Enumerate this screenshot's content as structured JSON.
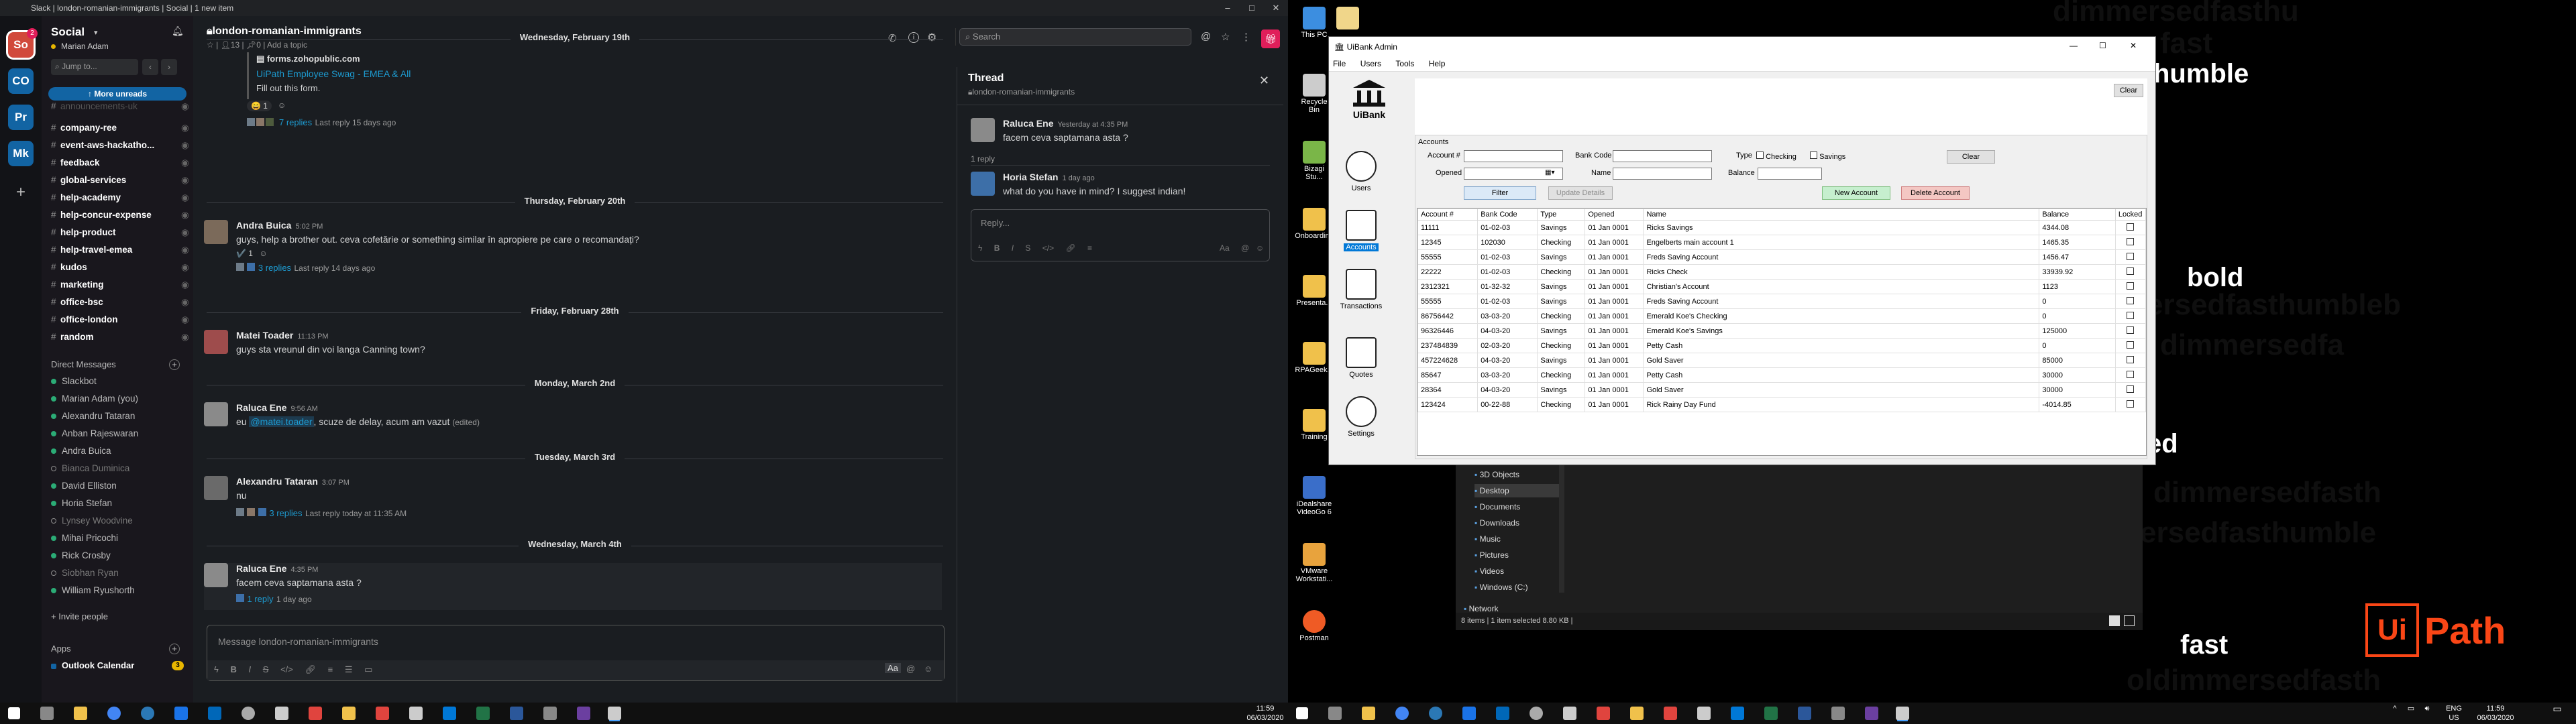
{
  "slack": {
    "window_title": "Slack | london-romanian-immigrants | Social | 1 new item",
    "workspaces": [
      {
        "label": "So",
        "color": "#d1493b",
        "badge": "2"
      },
      {
        "label": "CO",
        "color": "#1264a3"
      },
      {
        "label": "Pr",
        "color": "#1264a3"
      },
      {
        "label": "Mk",
        "color": "#1264a3"
      }
    ],
    "add_workspace": "+",
    "workspace_name": "Social",
    "user_name": "Marian Adam",
    "jump_placeholder": "Jump to...",
    "more_unreads": "More unreads",
    "channels": [
      "announcements-uk",
      "company-ree",
      "event-aws-hackatho...",
      "feedback",
      "global-services",
      "help-academy",
      "help-concur-expense",
      "help-product",
      "help-travel-emea",
      "kudos",
      "marketing",
      "office-bsc",
      "office-london",
      "random"
    ],
    "dm_header": "Direct Messages",
    "dms": [
      {
        "name": "Slackbot",
        "online": true
      },
      {
        "name": "Marian Adam (you)",
        "online": true
      },
      {
        "name": "Alexandru Tataran",
        "online": true
      },
      {
        "name": "Anban Rajeswaran",
        "online": true
      },
      {
        "name": "Andra Buica",
        "online": true
      },
      {
        "name": "Bianca Duminica",
        "online": false
      },
      {
        "name": "David Elliston",
        "online": true
      },
      {
        "name": "Horia Stefan",
        "online": true
      },
      {
        "name": "Lynsey Woodvine",
        "online": false
      },
      {
        "name": "Mihai Pricochi",
        "online": true
      },
      {
        "name": "Rick Crosby",
        "online": true
      },
      {
        "name": "Siobhan Ryan",
        "online": false
      },
      {
        "name": "William Ryushorth",
        "online": true
      }
    ],
    "invite_people": "+ Invite people",
    "apps_header": "Apps",
    "apps": [
      {
        "name": "Outlook Calendar",
        "badge": "3"
      }
    ],
    "channel_header": {
      "name": "london-romanian-immigrants",
      "members": "13",
      "pins": "0",
      "add_topic": "Add a topic"
    },
    "search_placeholder": "Search",
    "messages_top": {
      "link_domain": "forms.zohopublic.com",
      "link_title": "UiPath Employee Swag - EMEA & All",
      "link_desc": "Fill out this form.",
      "reactions": "1",
      "replies": "7 replies",
      "last_reply": "Last reply 15 days ago"
    },
    "feed": [
      {
        "type": "date",
        "label": "Wednesday, February 19th"
      },
      {
        "type": "date",
        "label": "Thursday, February 20th"
      },
      {
        "type": "msg",
        "author": "Andra Buica",
        "time": "5:02 PM",
        "text": "guys, help a brother out. ceva cofetărie or something similar în apropiere pe care o recomandați?",
        "reaction": "1",
        "replies": "3 replies",
        "last_reply": "Last reply 14 days ago"
      },
      {
        "type": "date",
        "label": "Friday, February 28th"
      },
      {
        "type": "msg",
        "author": "Matei Toader",
        "time": "11:13 PM",
        "text": "guys sta vreunul din voi langa Canning town?"
      },
      {
        "type": "date",
        "label": "Monday, March 2nd"
      },
      {
        "type": "msg",
        "author": "Raluca Ene",
        "time": "9:56 AM",
        "text_prefix": "eu",
        "mention": "@matei.toader",
        "text_suffix": ", scuze de delay, acum am vazut",
        "edited": "(edited)"
      },
      {
        "type": "date",
        "label": "Tuesday, March 3rd"
      },
      {
        "type": "msg",
        "author": "Alexandru Tataran",
        "time": "3:07 PM",
        "text": "nu",
        "replies": "3 replies",
        "last_reply": "Last reply today at 11:35 AM"
      },
      {
        "type": "date",
        "label": "Wednesday, March 4th"
      },
      {
        "type": "msg",
        "author": "Raluca Ene",
        "time": "4:35 PM",
        "text": "facem ceva saptamana asta ?",
        "replies": "1 reply",
        "last_reply": "1 day ago"
      }
    ],
    "composer_placeholder": "Message london-romanian-immigrants",
    "thread": {
      "title": "Thread",
      "channel": "london-romanian-immigrants",
      "root_author": "Raluca Ene",
      "root_time": "Yesterday at 4:35 PM",
      "root_text": "facem ceva saptamana asta ?",
      "reply_count": "1 reply",
      "reply_author": "Horia Stefan",
      "reply_time": "1 day ago",
      "reply_text": "what do you have in mind? I suggest indian!",
      "reply_placeholder": "Reply..."
    }
  },
  "desktop": {
    "bg_words": [
      "dimmersedfasthu",
      "fast",
      "dimmersedfastl",
      "humble",
      "bold",
      "ersedfasthumbleb",
      "dimmersedfa",
      "ed",
      "fast",
      "dimmersedfasth",
      "ersedfasthumble",
      "oldimmersedfasth"
    ],
    "highlight_words": [
      "humble",
      "bold",
      "ed",
      "fast"
    ],
    "icons": [
      "This PC",
      "",
      "Recycle Bin",
      "Bizagi Stu...",
      "Onboarding",
      "Presenta...",
      "RPAGeek...",
      "Training",
      "iDealshare VideoGo 6",
      "VMware Workstati...",
      "Postman"
    ],
    "brand_logo": "UiPath",
    "explorer": {
      "tree": [
        "3D Objects",
        "Desktop",
        "Documents",
        "Downloads",
        "Music",
        "Pictures",
        "Videos",
        "Windows (C:)",
        "Network"
      ],
      "status": "8 items  |  1 item selected  8.80 KB  |"
    }
  },
  "uibank": {
    "title": "UiBank Admin",
    "menu": [
      "File",
      "Users",
      "Tools",
      "Help"
    ],
    "logo_label": "UiBank",
    "clear_top": "Clear",
    "nav": [
      "Users",
      "Accounts",
      "Transactions",
      "Quotes",
      "Settings"
    ],
    "section": "Accounts",
    "form": {
      "account_label": "Account #",
      "bank_code_label": "Bank Code",
      "type_label": "Type",
      "checking_label": "Checking",
      "savings_label": "Savings",
      "clear_label": "Clear",
      "opened_label": "Opened",
      "name_label": "Name",
      "balance_label": "Balance",
      "filter_label": "Filter",
      "update_label": "Update Details",
      "new_account_label": "New Account",
      "delete_account_label": "Delete Account"
    },
    "columns": [
      "Account #",
      "Bank Code",
      "Type",
      "Opened",
      "Name",
      "Balance",
      "Locked"
    ],
    "rows": [
      [
        "11111",
        "01-02-03",
        "Savings",
        "01 Jan 0001",
        "Ricks Savings",
        "4344.08"
      ],
      [
        "12345",
        "102030",
        "Checking",
        "01 Jan 0001",
        "Engelberts main account 1",
        "1465.35"
      ],
      [
        "55555",
        "01-02-03",
        "Savings",
        "01 Jan 0001",
        "Freds Saving Account",
        "1456.47"
      ],
      [
        "22222",
        "01-02-03",
        "Checking",
        "01 Jan 0001",
        "Ricks Check",
        "33939.92"
      ],
      [
        "2312321",
        "01-32-32",
        "Savings",
        "01 Jan 0001",
        "Christian's Account",
        "1123"
      ],
      [
        "55555",
        "01-02-03",
        "Savings",
        "01 Jan 0001",
        "Freds Saving Account",
        "0"
      ],
      [
        "86756442",
        "03-03-20",
        "Checking",
        "01 Jan 0001",
        "Emerald Koe's Checking",
        "0"
      ],
      [
        "96326446",
        "04-03-20",
        "Savings",
        "01 Jan 0001",
        "Emerald Koe's Savings",
        "125000"
      ],
      [
        "237484839",
        "02-03-20",
        "Checking",
        "01 Jan 0001",
        "Petty Cash",
        "0"
      ],
      [
        "457224628",
        "04-03-20",
        "Savings",
        "01 Jan 0001",
        "Gold Saver",
        "85000"
      ],
      [
        "85647",
        "03-03-20",
        "Checking",
        "01 Jan 0001",
        "Petty Cash",
        "30000"
      ],
      [
        "28364",
        "04-03-20",
        "Savings",
        "01 Jan 0001",
        "Gold Saver",
        "30000"
      ],
      [
        "123424",
        "00-22-88",
        "Checking",
        "01 Jan 0001",
        "Rick Rainy Day Fund",
        "-4014.85"
      ]
    ]
  },
  "taskbar": {
    "left_clock_time": "11:59",
    "left_clock_date": "06/03/2020",
    "right_clock_time": "11:59",
    "right_clock_date": "06/03/2020",
    "lang": "ENG",
    "region": "US"
  }
}
